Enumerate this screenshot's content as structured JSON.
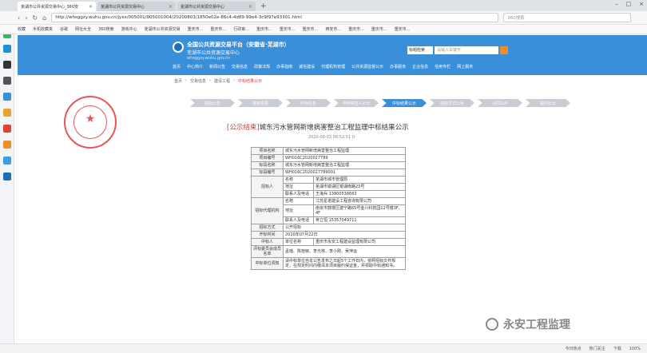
{
  "tabs": [
    {
      "label": "芜湖市公共资源交易中心_360安"
    },
    {
      "label": "芜湖市公共资源交易中心"
    },
    {
      "label": "芜湖市公共资源交易中心"
    }
  ],
  "address": {
    "url": "http://whsggzy.wuhu.gov.cn/jyxx/005001/005001004/20200803/1850e02e-86c4-4d89-99e4-3c9f97e93301.html",
    "search_hint": "360搜索"
  },
  "bookmarks": [
    "收藏",
    "手机收藏夹",
    "谷歌",
    "网址大全",
    "360搜索",
    "游戏中心",
    "芜湖市公共资源交易",
    "重庆市...",
    "重庆市...",
    "行政审...",
    "重庆市...",
    "重庆市...",
    "重庆市...",
    "西安市...",
    "重庆市...",
    "重庆市...",
    "重庆市..."
  ],
  "site": {
    "title": "全国公共资源交易平台（安徽省·芜湖市）",
    "subtitle": "芜湖市公共资源交易中心",
    "url_text": "whsggzy.wuhu.gov.cn",
    "search_select": "标题检索",
    "search_placeholder": "请输入关键字"
  },
  "nav": [
    "首页",
    "中心简介",
    "新闻公告",
    "交易信息",
    "政策法规",
    "办事指南",
    "诚信建设",
    "代理机构管理",
    "公共资源监督公示",
    "办事服务",
    "企业信息",
    "信用专栏",
    "网上服务"
  ],
  "breadcrumb": [
    "首页",
    "交易信息",
    "建设工程",
    "中标结果公示"
  ],
  "steps": [
    "招标公告",
    "答疑变更",
    "开标信息",
    "中标候选人公示",
    "中标结果公示",
    "招标方式公示",
    "合同公示",
    "履约公示"
  ],
  "title_tag": "[公示结束]",
  "title_text": "城东污水管网新增病害整治工程监理中标结果公示",
  "pub_date": "2020-08-03 08:52:51 0",
  "table": {
    "project_name_label": "项目名称",
    "project_name": "城东污水管网新增病害整治工程监理",
    "project_no_label": "项目编号",
    "project_no": "WH016C2020027789",
    "section_name_label": "标段名称",
    "section_name": "城东污水管网新增病害整治工程监理",
    "section_no_label": "标段编号",
    "section_no": "WH016C2020027789001",
    "tenderer_label": "招标人",
    "name_label": "名称",
    "tenderer_name": "芜湖市城市管理局",
    "addr_label": "地址",
    "tenderer_addr": "芜湖市镜湖区银湖南路23号",
    "contact_label": "联系人及电话",
    "tenderer_contact": "王海兵 13800538663",
    "agent_label": "招标代理机构",
    "agent_name": "江苏星诺建设工程咨询有限公司",
    "agent_addr": "南京市鼓楼区建宁路65号金川科技园12号楼3F、4F",
    "agent_contact": "蒋立恒 15357049711",
    "method_label": "招标方式",
    "method": "公开招标",
    "open_time_label": "开标时间",
    "open_time": "2020年07月22日",
    "winner_label": "中标人",
    "winner_unit_label": "单位名称",
    "winner_name": "重庆市永安工程建设监理有限公司",
    "committee_label": "评标委员会成员名单",
    "committee": "孟瑶、陈桂敏、李光林、李小刚、吴萍运",
    "notice_label": "中标单位须知",
    "notice": "请中标单位自本公告发布之日起5个工作日内，依照招标文件规定，在规定时间内缴清本项目履约保证金，并领取中标通知书。"
  },
  "watermark": "永安工程监理",
  "status": [
    "今日热点",
    "热门关注",
    "下载",
    "100%"
  ]
}
